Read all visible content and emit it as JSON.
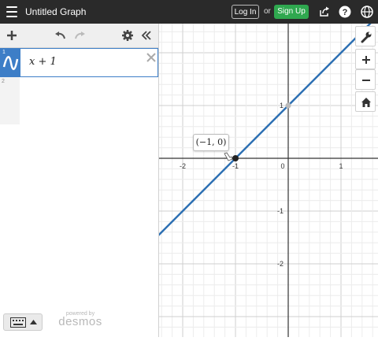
{
  "topbar": {
    "title": "Untitled Graph",
    "login_label": "Log In",
    "or_label": "or",
    "signup_label": "Sign Up",
    "icons": [
      "menu-icon",
      "share-icon",
      "help-icon",
      "globe-icon"
    ]
  },
  "panel": {
    "toolbar_icons": [
      "add-icon",
      "undo-icon",
      "redo-icon",
      "settings-icon",
      "collapse-icon"
    ],
    "expressions": [
      {
        "index": "1",
        "latex": "x + 1",
        "color": "#3d7ec7"
      },
      {
        "index": "2",
        "latex": ""
      }
    ],
    "powered_by": "powered by",
    "brand": "desmos"
  },
  "graph": {
    "x_ticks": [
      "-2",
      "-1",
      "0",
      "1"
    ],
    "y_ticks": [
      "1",
      "-1",
      "-2"
    ],
    "point_label": "(−1, 0)",
    "line_color": "#2d70b3",
    "zoom_icons": [
      "wrench-icon",
      "zoom-in-icon",
      "zoom-out-icon",
      "home-icon"
    ]
  }
}
